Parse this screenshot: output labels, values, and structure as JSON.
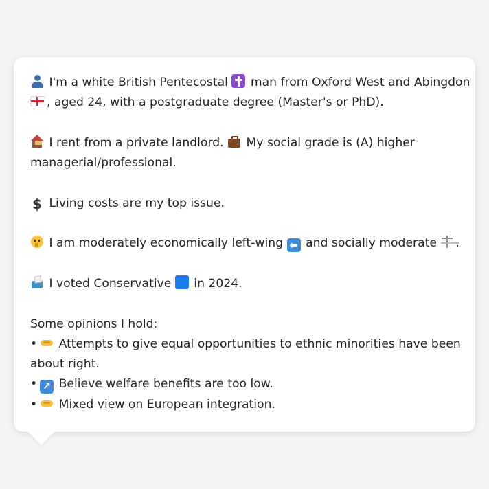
{
  "profile": {
    "intro_line1_a": "I'm a white British Pentecostal",
    "intro_line1_b": "man from Oxford West and Abingdon",
    "intro_line2": ", aged 24, with a postgraduate degree (Master's or PhD).",
    "housing_line1_a": "I rent from a private landlord.",
    "housing_line1_b": "My social grade is (A) higher",
    "housing_line2": "managerial/professional.",
    "issue": "Living costs are my top issue.",
    "ideology_a": "I am moderately economically left-wing",
    "ideology_b": "and socially moderate",
    "ideology_end": ".",
    "vote_a": "I voted Conservative",
    "vote_b": "in 2024."
  },
  "opinions": {
    "heading": "Some opinions I hold:",
    "bullet": "•",
    "items": [
      {
        "line1": "Attempts to give equal opportunities to ethnic minorities have been",
        "line2": "about right.",
        "icon": "handshake-icon"
      },
      {
        "line1": "Believe welfare benefits are too low.",
        "icon": "up-right-arrow-icon"
      },
      {
        "line1": "Mixed view on European integration.",
        "icon": "handshake-icon"
      }
    ]
  },
  "icons": {
    "person": "person-icon",
    "cross": "latin-cross-icon",
    "flag": "england-flag-icon",
    "house": "house-icon",
    "briefcase": "briefcase-icon",
    "dollar": "heavy-dollar-sign-icon",
    "dollar_glyph": "$",
    "thinking": "thinking-face-icon",
    "left_arrow": "left-arrow-icon",
    "left_arrow_glyph": "⬅",
    "scales": "balance-scale-icon",
    "ballot": "ballot-box-icon",
    "blue_square": "blue-square-icon",
    "up_right_glyph": "↗"
  },
  "colors": {
    "background": "#f3f4f6",
    "bubble": "#ffffff",
    "text": "#1f2328",
    "conservative_blue": "#1b7cf0"
  }
}
